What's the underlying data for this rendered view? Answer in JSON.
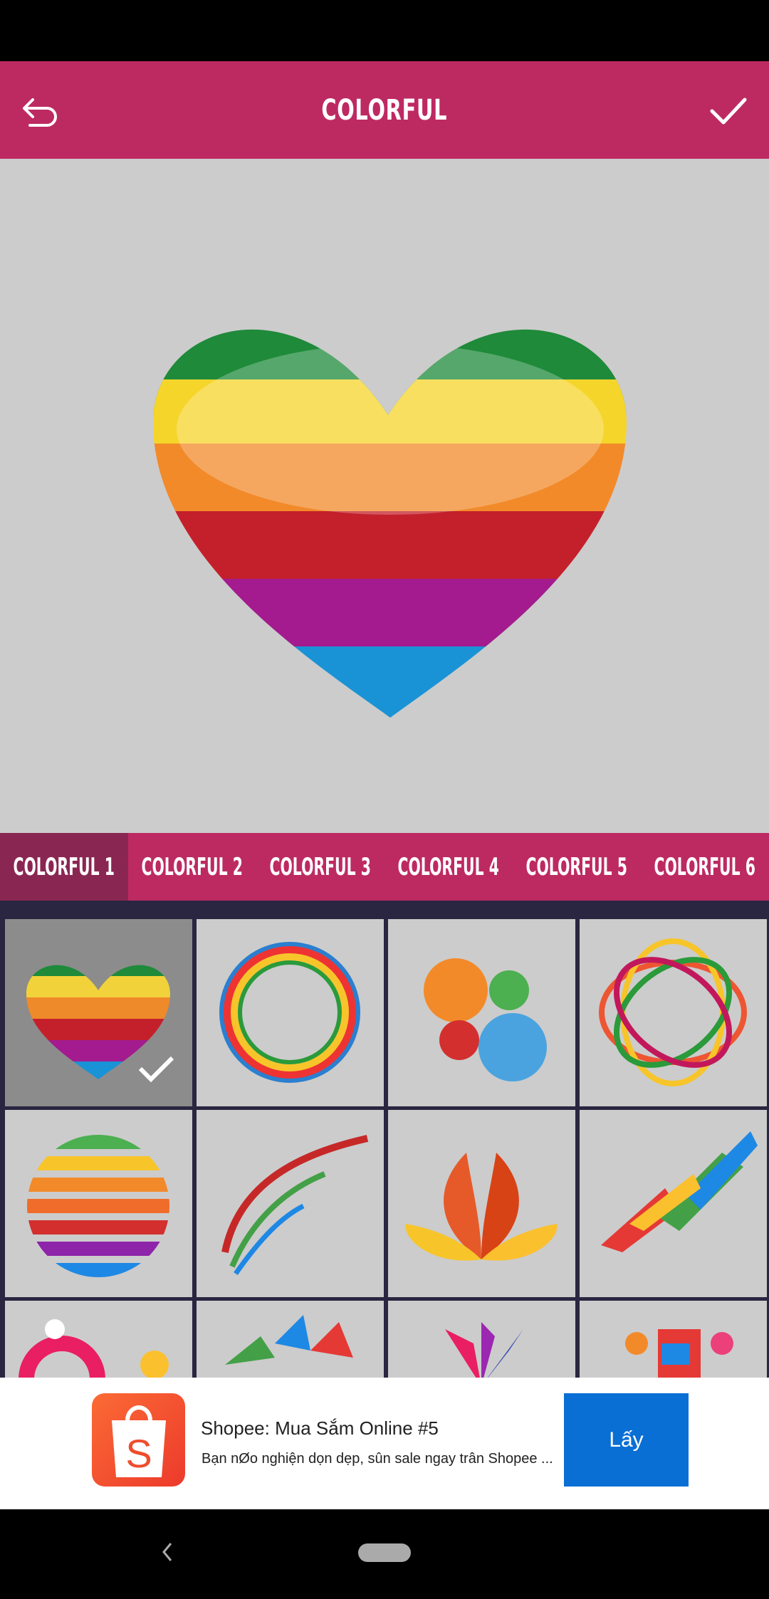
{
  "header": {
    "title": "COLORFUL",
    "back_icon": "undo-arrow-icon",
    "confirm_icon": "check-icon"
  },
  "tabs": [
    {
      "label": "COLORFUL 1",
      "active": true
    },
    {
      "label": "COLORFUL 2"
    },
    {
      "label": "COLORFUL 3"
    },
    {
      "label": "COLORFUL 4"
    },
    {
      "label": "COLORFUL 5"
    },
    {
      "label": "COLORFUL 6"
    }
  ],
  "grid": {
    "selected_index": 0,
    "items": [
      "rainbow-heart",
      "rainbow-ring",
      "four-hearts",
      "rainbow-loops",
      "striped-globe",
      "arrows",
      "lotus",
      "shards",
      "dots",
      "shapes",
      "petals",
      "figures"
    ]
  },
  "colors": {
    "accent": "#bd2a62",
    "tab_active": "#8a2652",
    "grid_bg": "#2a2540",
    "ad_button": "#0a6fd4"
  },
  "ad": {
    "title": "Shopee: Mua Sắm Online #5",
    "description": "Bạn nØo nghiện dọn dẹp, sûn sale ngay trân Shopee ...",
    "button": "Lấy",
    "icon": "shopee-bag-icon"
  }
}
